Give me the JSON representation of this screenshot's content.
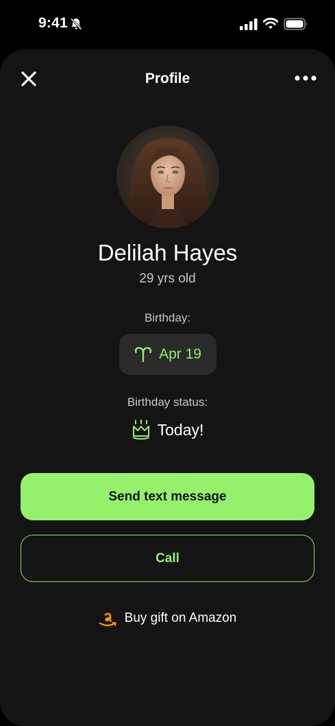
{
  "status_bar": {
    "time": "9:41"
  },
  "header": {
    "title": "Profile",
    "close_icon": "close-icon",
    "more_icon": "more-horizontal-icon"
  },
  "profile": {
    "name": "Delilah Hayes",
    "age": "29 yrs old",
    "birthday_label": "Birthday:",
    "zodiac_icon": "aries-icon",
    "birthday_date": "Apr 19",
    "status_label": "Birthday status:",
    "status_icon": "crown-icon",
    "status_value": "Today!"
  },
  "actions": {
    "send_text": "Send text message",
    "call": "Call",
    "amazon_icon": "amazon-icon",
    "amazon_gift": "Buy gift on Amazon"
  },
  "colors": {
    "accent": "#95f16c",
    "sheet_background": "#141414",
    "chip_background": "#2a2a2a"
  }
}
